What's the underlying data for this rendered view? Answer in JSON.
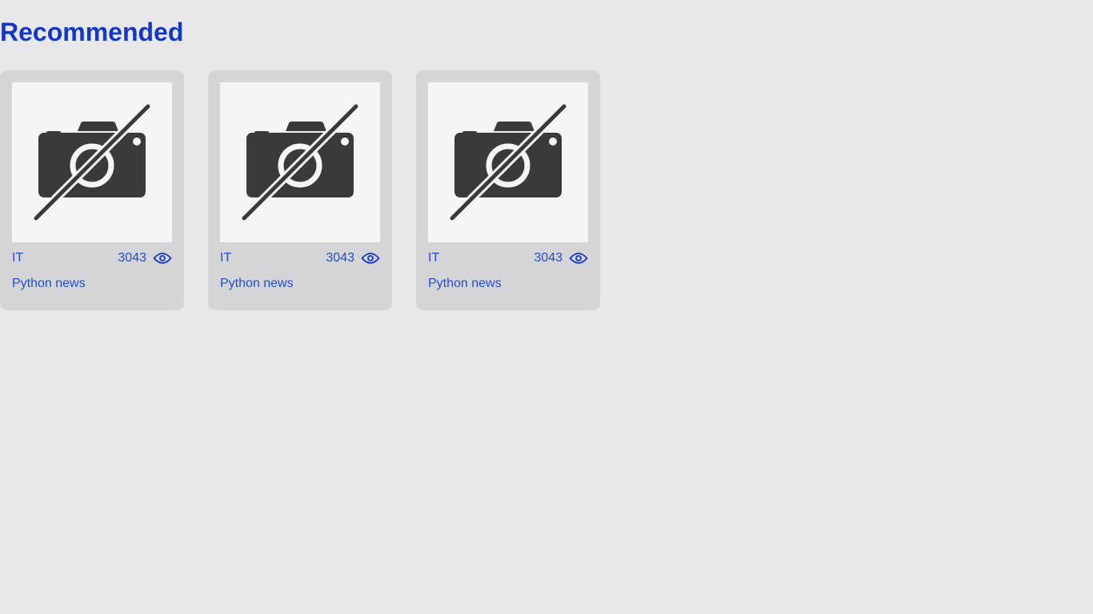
{
  "page": {
    "title": "Recommended"
  },
  "cards": [
    {
      "category": "IT",
      "views": "3043",
      "title": "Python news",
      "image_icon": "no-photo-icon"
    },
    {
      "category": "IT",
      "views": "3043",
      "title": "Python news",
      "image_icon": "no-photo-icon"
    },
    {
      "category": "IT",
      "views": "3043",
      "title": "Python news",
      "image_icon": "no-photo-icon"
    }
  ],
  "colors": {
    "background": "#e8e8eb",
    "card": "#d5d5d8",
    "accent": "#1238c4",
    "link": "#1f4fd0",
    "icon": "#3a3a3a"
  }
}
